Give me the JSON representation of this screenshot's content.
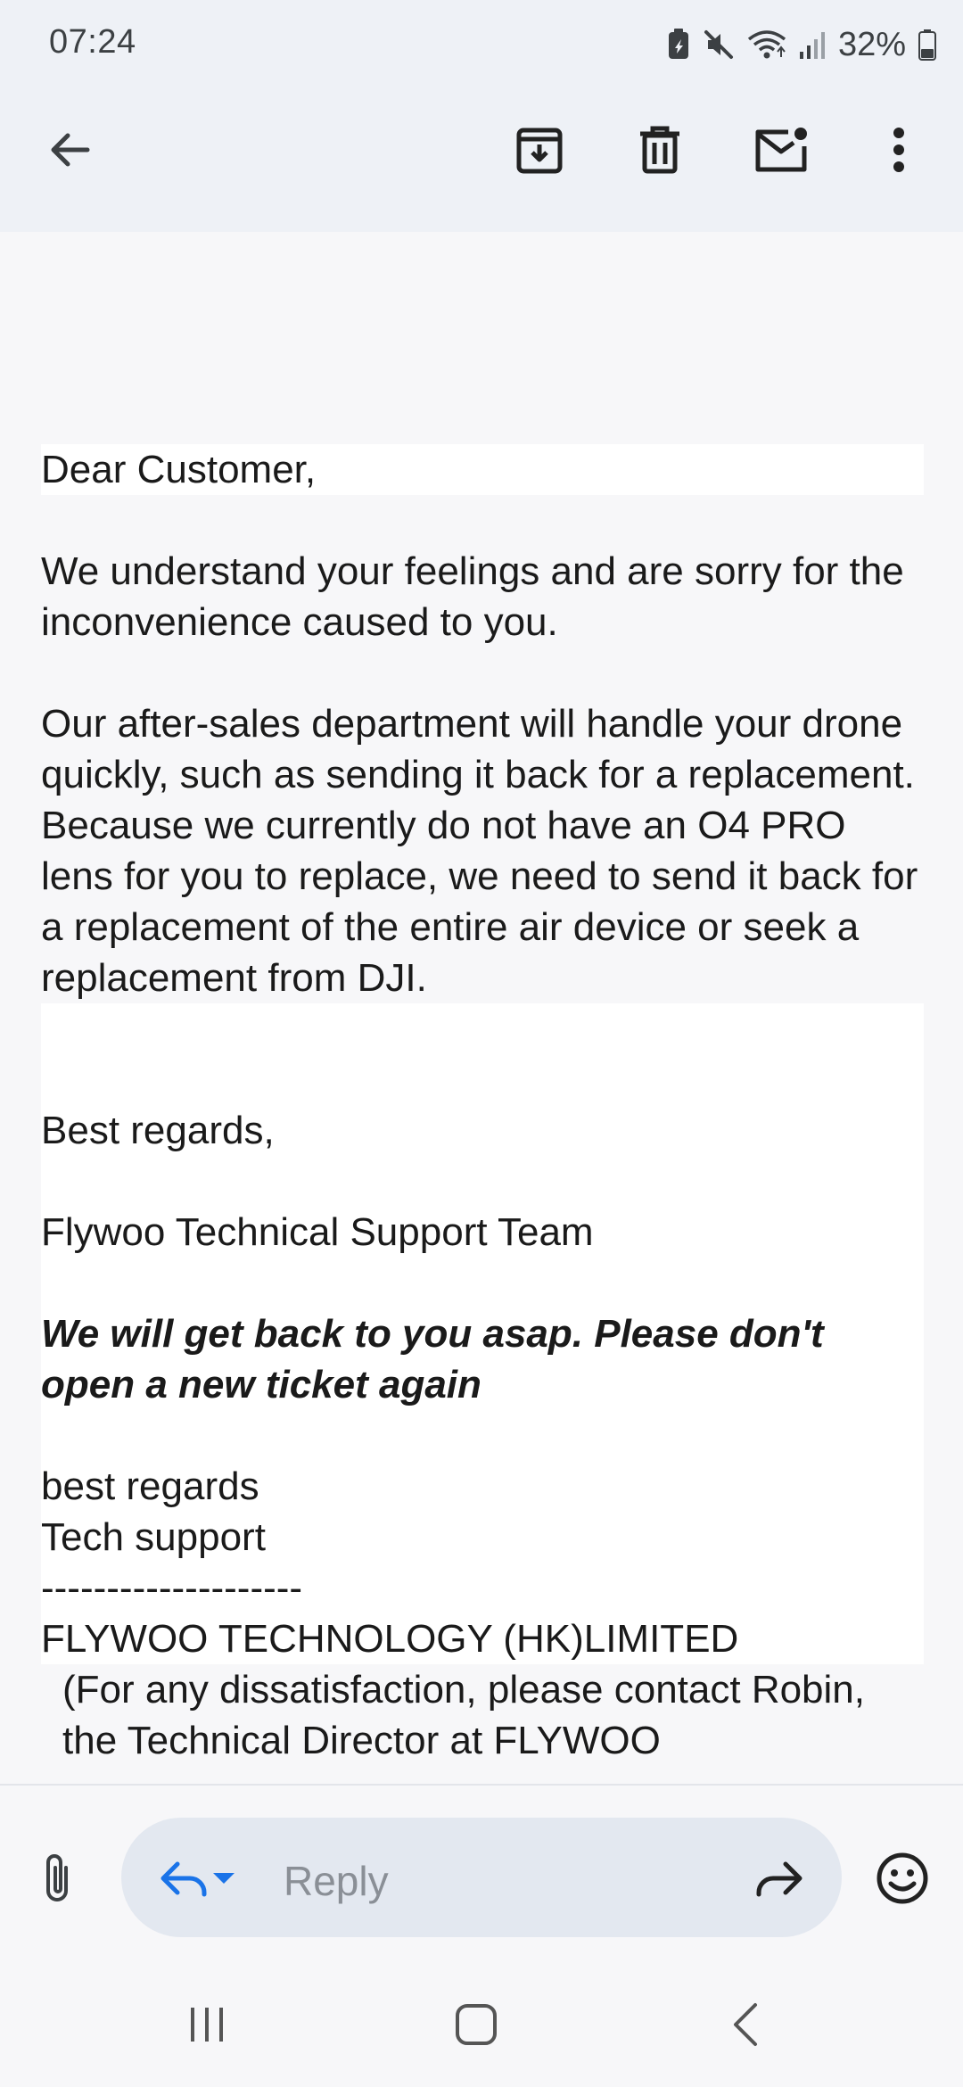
{
  "status_bar": {
    "time": "07:24",
    "battery": "32%",
    "icons": [
      "battery-saver-icon",
      "mute-icon",
      "wifi-icon",
      "signal-icon",
      "battery-icon"
    ]
  },
  "toolbar": {
    "back_icon": "arrow-back-icon",
    "archive_icon": "archive-icon",
    "delete_icon": "trash-icon",
    "mark_unread_icon": "mail-unread-icon",
    "more_icon": "more-vert-icon"
  },
  "message": {
    "greeting": "Dear Customer,",
    "para1": "We understand your feelings and are sorry for the inconvenience caused to you.",
    "para2": "Our after-sales department will handle your drone quickly, such as sending it back for a replacement. Because we currently do not have an O4 PRO lens for you to replace, we need to send it back for a replacement of the entire air device or seek a replacement from DJI.",
    "closing": "Best regards,",
    "team": "Flywoo Technical Support Team",
    "notice": "We will get back to you asap. Please don't open a new ticket again",
    "sig_line1": "best regards",
    "sig_line2": "Tech support",
    "divider": "--------------------",
    "company": "FLYWOO TECHNOLOGY (HK)LIMITED",
    "contact_note": "(For any dissatisfaction, please contact Robin,",
    "contact_note_cut": "the Technical Director at FLYWOO"
  },
  "reply_bar": {
    "placeholder": "Reply",
    "attach_icon": "paperclip-icon",
    "reply_icon": "reply-icon",
    "dropdown_icon": "caret-down-icon",
    "forward_icon": "forward-icon",
    "emoji_icon": "emoji-icon"
  },
  "nav_bar": {
    "recents_icon": "recents-icon",
    "home_icon": "home-icon",
    "back_icon": "nav-back-icon"
  },
  "colors": {
    "header_bg": "#eef1f6",
    "body_bg": "#f7f7f9",
    "reply_pill": "#e3e8f0",
    "icon": "#3c4043"
  }
}
